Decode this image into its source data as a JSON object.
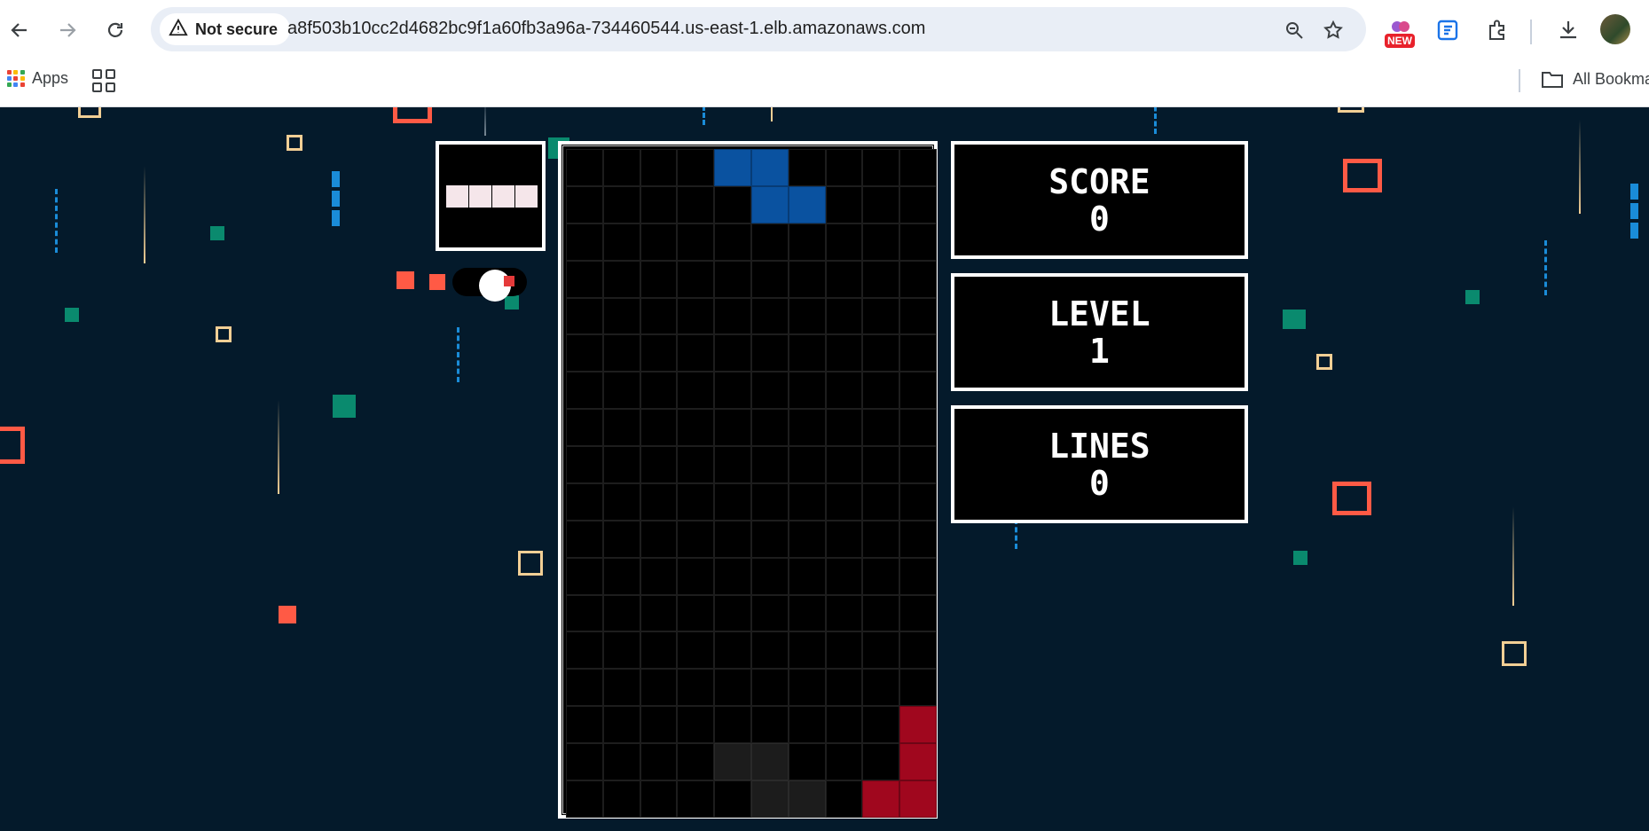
{
  "browser": {
    "security_label": "Not secure",
    "url": "a8f503b10cc2d4682bc9f1a60fb3a96a-734460544.us-east-1.elb.amazonaws.com",
    "extension_badge": "NEW",
    "icons": [
      "back-icon",
      "forward-icon",
      "reload-icon",
      "warning-icon",
      "zoom-icon",
      "star-icon",
      "extension-icon",
      "sidebar-icon",
      "puzzle-icon",
      "download-icon"
    ]
  },
  "bookmarks": {
    "apps_label": "Apps",
    "all_bookmarks_label": "All Bookma"
  },
  "game": {
    "stats": [
      {
        "label": "SCORE",
        "value": "0"
      },
      {
        "label": "LEVEL",
        "value": "1"
      },
      {
        "label": "LINES",
        "value": "0"
      }
    ],
    "next_piece": {
      "shape": "I",
      "color": "#f5e6ea"
    },
    "board": {
      "cols": 10,
      "rows": 18,
      "filled": [
        {
          "row": 0,
          "col": 4,
          "color": "blue"
        },
        {
          "row": 0,
          "col": 5,
          "color": "blue"
        },
        {
          "row": 1,
          "col": 5,
          "color": "blue"
        },
        {
          "row": 1,
          "col": 6,
          "color": "blue"
        },
        {
          "row": 15,
          "col": 9,
          "color": "red"
        },
        {
          "row": 16,
          "col": 9,
          "color": "red"
        },
        {
          "row": 17,
          "col": 8,
          "color": "red"
        },
        {
          "row": 17,
          "col": 9,
          "color": "red"
        },
        {
          "row": 16,
          "col": 4,
          "color": "gray"
        },
        {
          "row": 16,
          "col": 5,
          "color": "gray"
        },
        {
          "row": 17,
          "col": 5,
          "color": "gray"
        },
        {
          "row": 17,
          "col": 6,
          "color": "gray"
        }
      ]
    },
    "colors": {
      "background": "#041a2b",
      "blue": "#0a52a0",
      "red": "#a0071e",
      "gray": "#1c1c1c",
      "accent_red": "#ff5a45",
      "accent_teal": "#0a8a6e",
      "accent_cream": "#f2cf95",
      "accent_blue": "#1a8cd8"
    }
  }
}
